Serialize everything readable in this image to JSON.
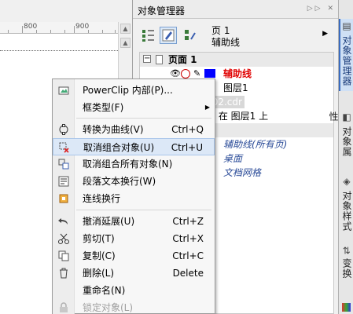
{
  "canvas": {
    "ruler_labels": [
      "800",
      "900"
    ]
  },
  "panel": {
    "title": "对象管理器",
    "page_name": "页 1",
    "layer_name": "辅助线",
    "tree": {
      "page": "页面 1",
      "guides_layer": "辅助线",
      "layer1": "图层1",
      "file_tag": "t02.cdr",
      "status": "线 在 图层1 上",
      "master_guides": "辅助线(所有页)",
      "master_desktop": "桌面",
      "master_grid": "文档网格"
    }
  },
  "dock_tabs": [
    "对象管理器",
    "对象属性",
    "对象样式",
    "变换"
  ],
  "menu": {
    "items": [
      {
        "label": "PowerClip 内部(P)...",
        "shortcut": "",
        "icon": "powerclip-icon"
      },
      {
        "label": "框类型(F)",
        "shortcut": "",
        "icon": "",
        "submenu": true
      },
      {
        "label": "转换为曲线(V)",
        "shortcut": "Ctrl+Q",
        "icon": "convert-curve-icon"
      },
      {
        "label": "取消组合对象(U)",
        "shortcut": "Ctrl+U",
        "icon": "ungroup-icon",
        "highlighted": true
      },
      {
        "label": "取消组合所有对象(N)",
        "shortcut": "",
        "icon": "ungroup-all-icon"
      },
      {
        "label": "段落文本换行(W)",
        "shortcut": "",
        "icon": "paragraph-wrap-icon"
      },
      {
        "label": "连线换行",
        "shortcut": "",
        "icon": "connector-wrap-icon"
      },
      {
        "label": "撤消延展(U)",
        "shortcut": "Ctrl+Z",
        "icon": "undo-icon"
      },
      {
        "label": "剪切(T)",
        "shortcut": "Ctrl+X",
        "icon": "cut-icon"
      },
      {
        "label": "复制(C)",
        "shortcut": "Ctrl+C",
        "icon": "copy-icon"
      },
      {
        "label": "删除(L)",
        "shortcut": "Delete",
        "icon": "delete-icon"
      },
      {
        "label": "重命名(N)",
        "shortcut": "",
        "icon": ""
      },
      {
        "label": "锁定对象(L)",
        "shortcut": "",
        "icon": "lock-icon",
        "disabled": true
      }
    ]
  },
  "colors": {
    "highlight": "#dce8f7",
    "accent_blue": "#0000ff",
    "guides_red": "#e00000"
  }
}
